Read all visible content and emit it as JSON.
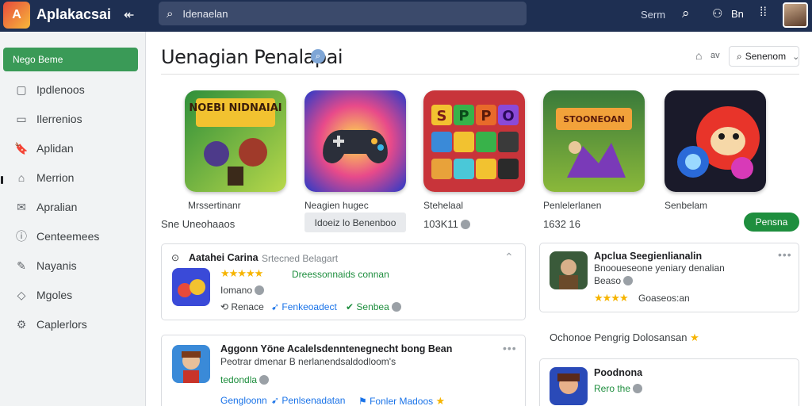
{
  "app": {
    "title": "Aplakacsai",
    "logo_text": "A"
  },
  "search": {
    "placeholder": "Idenaelan"
  },
  "topbar": {
    "right_text": "Serm",
    "user_label": "Bn"
  },
  "sidebar": {
    "primary": "Nego Beme",
    "items": [
      {
        "icon": "calendar-icon",
        "glyph": "▢",
        "label": "Ipdlenoos"
      },
      {
        "icon": "clipboard-icon",
        "glyph": "▭",
        "label": "Ilerrenios"
      },
      {
        "icon": "bookmark-icon",
        "glyph": "🔖",
        "label": "Aplidan"
      },
      {
        "icon": "home-icon",
        "glyph": "⌂",
        "label": "Merrion"
      },
      {
        "icon": "mail-icon",
        "glyph": "✉",
        "label": "Apralian"
      },
      {
        "icon": "info-icon",
        "glyph": "ⓘ",
        "label": "Centeemees"
      },
      {
        "icon": "edit-icon",
        "glyph": "✎",
        "label": "Nayanis"
      },
      {
        "icon": "tag-icon",
        "glyph": "◇",
        "label": "Mgoles"
      },
      {
        "icon": "gear-icon",
        "glyph": "⚙",
        "label": "Caplerlors"
      }
    ]
  },
  "main": {
    "title": "Uenagian Penalapai",
    "home_label": "av",
    "sort_button": "Senenom",
    "tiles": [
      {
        "label": "Mrssertinanr",
        "art": "NOEBI NIDNAIAI"
      },
      {
        "label": "Neagien hugec"
      },
      {
        "label": "Stehelaal",
        "art": "SPPO"
      },
      {
        "label": "Penlelerlanen",
        "art": "STOONEOAN"
      },
      {
        "label": "Senbelam"
      }
    ],
    "sub_left": "Sne  Uneohaaos",
    "chip": "Idoeiz  lo  Benenboo",
    "rating_text": "103K11",
    "rating_text2": "1632  16",
    "green_button": "Pensna"
  },
  "cards": {
    "c1": {
      "title": "Aatahei Carina",
      "meta": "Srtecned Belagart",
      "stars": "★★★★★",
      "green_text": "Dreessonnaids  connan",
      "sub": "Iomano",
      "actions": [
        "Renace",
        "Fenkeoadect",
        "Senbea"
      ]
    },
    "c2": {
      "title": "Apclua Seegienlianalin",
      "line2": "Bnooueseone yeniary denalian",
      "line3": "Beaso",
      "stars": "★★★★",
      "after_stars": "Goaseos:an"
    },
    "c3": {
      "title": "Aggonn Yöne Acalelsdenntenegnecht bong Bean",
      "line2": "Peotrar dmenar  B nerlanendsaldodloom's",
      "green_text": "tedondla",
      "actions": [
        "Gengloonn",
        "Penlsenadatan",
        "Fonler Madoos"
      ]
    },
    "side_text": "Ochonoe  Pengrig  Dolosansan",
    "c4": {
      "title": "Poodnona",
      "green_text": "Rero  the"
    }
  },
  "colors": {
    "topbar": "#1e2f52",
    "accent_green": "#3a9a57",
    "button_green": "#1e8e3e"
  }
}
